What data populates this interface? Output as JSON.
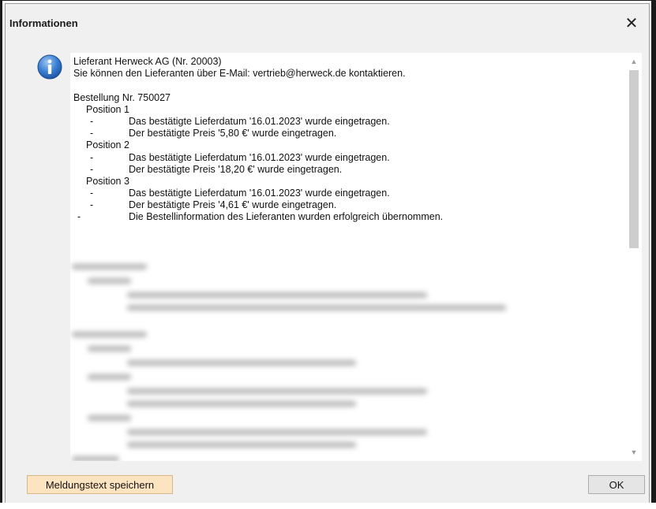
{
  "window": {
    "title": "Informationen",
    "close_symbol": "✕"
  },
  "icon": {
    "name": "information-icon",
    "color": "#2f6fc4"
  },
  "message": {
    "lines": [
      {
        "indent": 0,
        "dash": false,
        "text": "Lieferant Herweck AG (Nr. 20003)"
      },
      {
        "indent": 0,
        "dash": false,
        "text": "Sie können den Lieferanten über E-Mail: vertrieb@herweck.de kontaktieren."
      },
      {
        "indent": 0,
        "dash": false,
        "text": ""
      },
      {
        "indent": 0,
        "dash": false,
        "text": "Bestellung Nr. 750027"
      },
      {
        "indent": 1,
        "dash": false,
        "text": "Position 1"
      },
      {
        "indent": 2,
        "dash": true,
        "text": "Das bestätigte Lieferdatum '16.01.2023' wurde eingetragen."
      },
      {
        "indent": 2,
        "dash": true,
        "text": "Der bestätigte Preis '5,80 €' wurde eingetragen."
      },
      {
        "indent": 1,
        "dash": false,
        "text": "Position 2"
      },
      {
        "indent": 2,
        "dash": true,
        "text": "Das bestätigte Lieferdatum '16.01.2023' wurde eingetragen."
      },
      {
        "indent": 2,
        "dash": true,
        "text": "Der bestätigte Preis '18,20 €' wurde eingetragen."
      },
      {
        "indent": 1,
        "dash": false,
        "text": "Position 3"
      },
      {
        "indent": 2,
        "dash": true,
        "text": "Das bestätigte Lieferdatum '16.01.2023' wurde eingetragen."
      },
      {
        "indent": 2,
        "dash": true,
        "text": "Der bestätigte Preis '4,61 €' wurde eingetragen."
      },
      {
        "indent": 3,
        "dash": true,
        "text": "Die Bestellinformation des Lieferanten wurden erfolgreich übernommen."
      }
    ]
  },
  "buttons": {
    "save_label": "Meldungstext speichern",
    "ok_label": "OK"
  },
  "colors": {
    "save_button_bg": "#fde4c0",
    "dialog_bg": "#f0f0f0"
  }
}
